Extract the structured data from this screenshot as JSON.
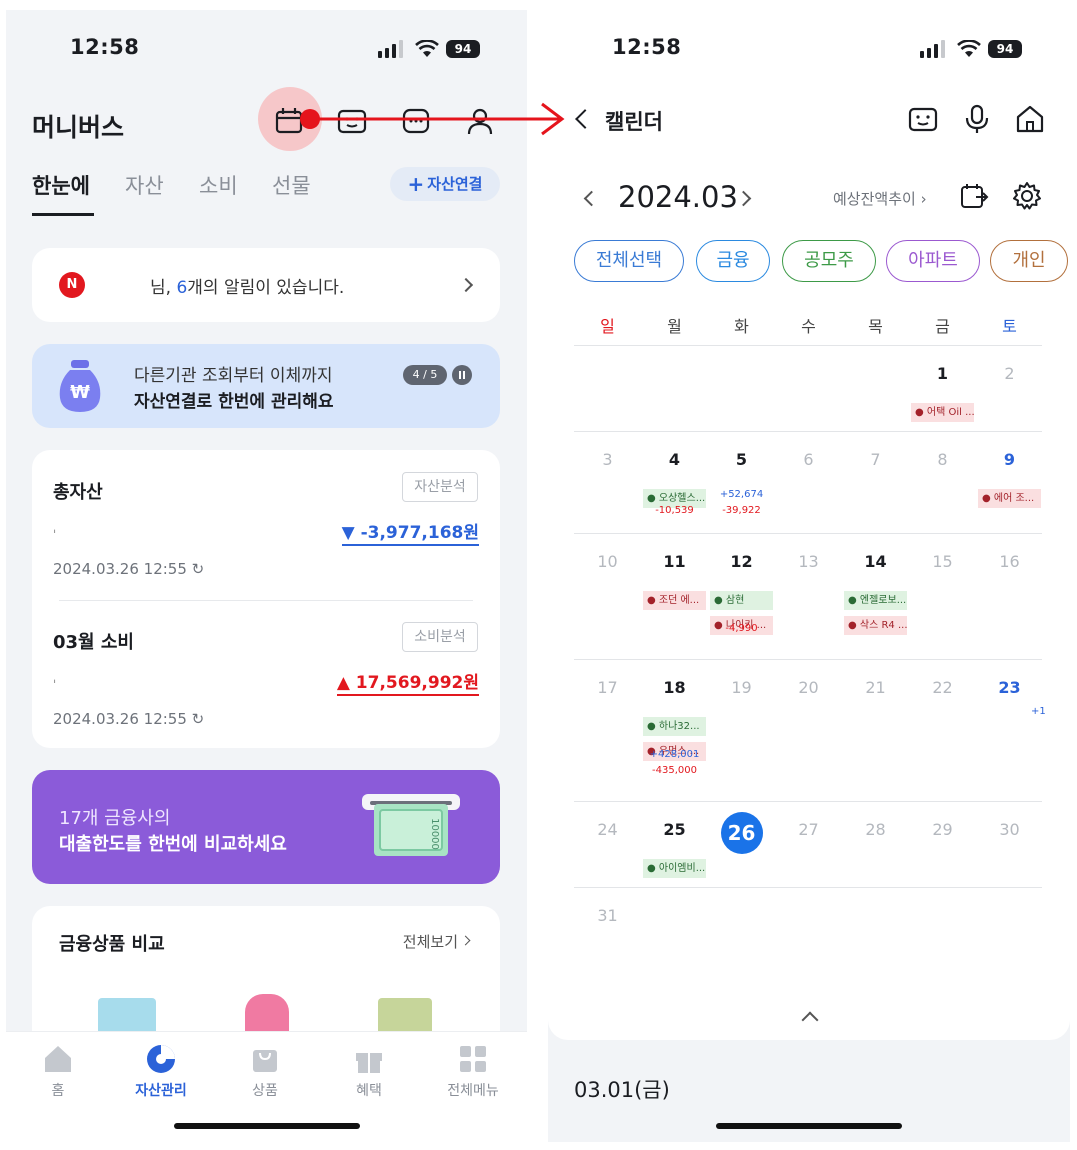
{
  "left": {
    "status": {
      "time": "12:58",
      "battery": "94"
    },
    "app_title": "머니버스",
    "tabs": [
      "한눈에",
      "자산",
      "소비",
      "선물"
    ],
    "connect_button": "자산연결",
    "notice": {
      "pre": "님, ",
      "count": "6",
      "post": "개의 알림이 있습니다.",
      "badge": "N"
    },
    "banner": {
      "line1": "다른기관 조회부터 이체까지",
      "line2": "자산연결로 한번에 관리해요",
      "pager": "4 / 5"
    },
    "total_assets": {
      "label": "총자산",
      "button": "자산분석",
      "change": "▼ -3,977,168원",
      "timestamp": "2024.03.26 12:55"
    },
    "spending": {
      "label": "03월 소비",
      "button": "소비분석",
      "change": "▲ 17,569,992원",
      "timestamp": "2024.03.26 12:55"
    },
    "loan_banner": {
      "line1": "17개 금융사의",
      "line2": "대출한도를 한번에 비교하세요"
    },
    "products": {
      "title": "금융상품 비교",
      "more": "전체보기"
    },
    "nav": [
      "홈",
      "자산관리",
      "상품",
      "혜택",
      "전체메뉴"
    ]
  },
  "right": {
    "status": {
      "time": "12:58",
      "battery": "94"
    },
    "title": "캘린더",
    "month": "2024.03",
    "trend_link": "예상잔액추이",
    "chips": [
      {
        "label": "전체선택",
        "color": "#3a7bd5"
      },
      {
        "label": "금융",
        "color": "#2b8ae0"
      },
      {
        "label": "공모주",
        "color": "#3d9a47"
      },
      {
        "label": "아파트",
        "color": "#9b59d0"
      },
      {
        "label": "개인",
        "color": "#b2703d"
      }
    ],
    "weekdays": [
      "일",
      "월",
      "화",
      "수",
      "목",
      "금",
      "토"
    ],
    "weekday_colors": [
      "#e2181f",
      "#444444",
      "#444444",
      "#444444",
      "#444444",
      "#444444",
      "#2b62d8"
    ],
    "weeks": [
      {
        "days": [
          "",
          "",
          "",
          "",
          "",
          "1",
          "2"
        ],
        "muted": [
          6
        ],
        "events": [
          {
            "col": 5,
            "row": 0,
            "color": "red",
            "label": "● 어택 Oil ..."
          }
        ],
        "amounts": []
      },
      {
        "days": [
          "3",
          "4",
          "5",
          "6",
          "7",
          "8",
          "9"
        ],
        "muted": [
          0,
          3,
          4,
          5
        ],
        "sat_blue": true,
        "events": [
          {
            "col": 1,
            "row": 0,
            "color": "green",
            "label": "● 오상헬스..."
          },
          {
            "col": 6,
            "row": 0,
            "color": "red",
            "label": "● 에어 조..."
          }
        ],
        "amounts": [
          {
            "col": 1,
            "line": 1,
            "tone": "red",
            "text": "-10,539"
          },
          {
            "col": 2,
            "line": 0,
            "tone": "blue",
            "text": "+52,674"
          },
          {
            "col": 2,
            "line": 1,
            "tone": "red",
            "text": "-39,922"
          }
        ]
      },
      {
        "days": [
          "10",
          "11",
          "12",
          "13",
          "14",
          "15",
          "16"
        ],
        "muted": [
          0,
          3,
          5,
          6
        ],
        "events": [
          {
            "col": 1,
            "row": 0,
            "color": "red",
            "label": "● 조던 에..."
          },
          {
            "col": 2,
            "row": 0,
            "color": "green",
            "label": "● 삼현"
          },
          {
            "col": 2,
            "row": 1,
            "color": "red",
            "label": "● 나이키 ..."
          },
          {
            "col": 4,
            "row": 0,
            "color": "green",
            "label": "● 엔젤로보..."
          },
          {
            "col": 4,
            "row": 1,
            "color": "red",
            "label": "● 삭스 R4 ..."
          }
        ],
        "amounts": [
          {
            "col": 2,
            "line": 2,
            "tone": "red",
            "text": "-4,990"
          }
        ]
      },
      {
        "days": [
          "17",
          "18",
          "19",
          "20",
          "21",
          "22",
          "23"
        ],
        "muted": [
          0,
          2,
          3,
          4,
          5
        ],
        "sat_blue": true,
        "events": [
          {
            "col": 1,
            "row": 0,
            "color": "green",
            "label": "● 하나32..."
          },
          {
            "col": 1,
            "row": 1,
            "color": "red",
            "label": "● 우먼스 ..."
          }
        ],
        "amounts": [
          {
            "col": 1,
            "line": 2,
            "tone": "blue",
            "text": "+428,001"
          },
          {
            "col": 1,
            "line": 3,
            "tone": "red",
            "text": "-435,000"
          }
        ],
        "more": "+1"
      },
      {
        "days": [
          "24",
          "25",
          "26",
          "27",
          "28",
          "29",
          "30"
        ],
        "muted": [
          0,
          3,
          4,
          5,
          6
        ],
        "today": 2,
        "events": [
          {
            "col": 1,
            "row": 0,
            "color": "green",
            "label": "● 아이엠비..."
          }
        ],
        "amounts": []
      },
      {
        "days": [
          "31",
          "",
          "",
          "",
          "",
          "",
          ""
        ],
        "muted": [
          0
        ],
        "events": [],
        "amounts": []
      }
    ],
    "selected_date": "03.01(금)"
  }
}
